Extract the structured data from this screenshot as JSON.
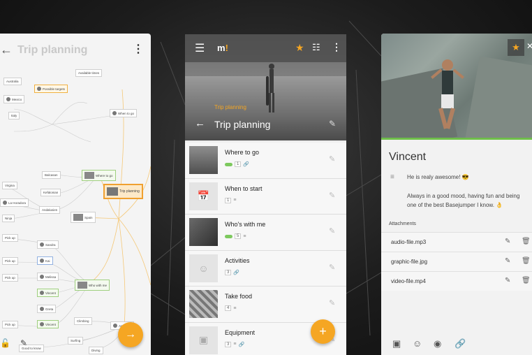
{
  "left_phone": {
    "title": "Trip planning",
    "back_icon": "arrow-left-icon",
    "more_icon": "more-vertical-icon",
    "central_node": "Trip planning",
    "nodes": [
      "Australia",
      "Mexico",
      "Italy",
      "Possible targets",
      "Available times",
      "When to go",
      "Where to go",
      "Balcasan",
      "Kefalonian",
      "Andalusien",
      "Spain",
      "Virgina",
      "La Horadora",
      "Ninja",
      "Pick up",
      "Sandra",
      "Kai",
      "Melissa",
      "Vincent",
      "Greta",
      "Vincent",
      "Who with me",
      "Pick up",
      "Pick up",
      "Pick up",
      "Climbing",
      "Activities",
      "Surfing",
      "Good to know",
      "Diving"
    ],
    "fab_icon": "arrow-right-icon",
    "bottom_icons": [
      "lock-icon",
      "edit-icon"
    ]
  },
  "center_phone": {
    "logo_text": "m",
    "logo_accent": "!",
    "breadcrumb": "Trip planning",
    "title": "Trip planning",
    "items": [
      {
        "name": "Where to go",
        "count": "1",
        "has_pill": true,
        "icon": "attachment-icon",
        "thumb": "photo"
      },
      {
        "name": "When to start",
        "count": "1",
        "has_pill": false,
        "icon": "notes-icon",
        "thumb": "calendar-icon"
      },
      {
        "name": "Who's with me",
        "count": "5",
        "has_pill": true,
        "icon": "notes-icon",
        "thumb": "photo"
      },
      {
        "name": "Activities",
        "count": "3",
        "has_pill": false,
        "icon": "attachment-icon",
        "thumb": "smiley-icon"
      },
      {
        "name": "Take food",
        "count": "4",
        "has_pill": false,
        "icon": "notes-icon",
        "thumb": "photo"
      },
      {
        "name": "Equipment",
        "count": "3",
        "has_pill": false,
        "icon": "notes-attachment-icon",
        "thumb": "box-icon"
      }
    ],
    "fab_label": "+"
  },
  "right_phone": {
    "name": "Vincent",
    "note_line1": "He is realy awesome! 😎",
    "note_line2": "Always in a good mood, having fun and being one of the best Basejumper I know. 👌",
    "attachments_label": "Attachments",
    "attachments": [
      "audio-file.mp3",
      "graphic-file.jpg",
      "video-file.mp4"
    ],
    "bottom_icons": [
      "image-icon",
      "emoji-icon",
      "palette-icon",
      "attachment-icon"
    ]
  },
  "colors": {
    "accent": "#f5a623",
    "green": "#7dc95e",
    "background": "#1c1c1c"
  }
}
